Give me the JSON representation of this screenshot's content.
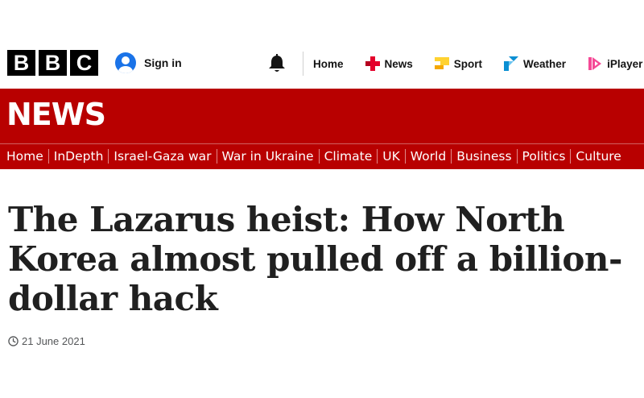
{
  "logo": {
    "letters": [
      "B",
      "B",
      "C"
    ]
  },
  "account": {
    "signin_label": "Sign in"
  },
  "topnav": [
    {
      "label": "Home",
      "icon": "none"
    },
    {
      "label": "News",
      "icon": "news-icon",
      "color": "#e4002b"
    },
    {
      "label": "Sport",
      "icon": "sport-icon",
      "color": "#ffd230"
    },
    {
      "label": "Weather",
      "icon": "weather-icon",
      "color": "#0a8fd3"
    },
    {
      "label": "iPlayer",
      "icon": "iplayer-icon",
      "color": "#f54996"
    }
  ],
  "news": {
    "logo": "NEWS",
    "bar_color": "#b80000",
    "sections": [
      "Home",
      "InDepth",
      "Israel-Gaza war",
      "War in Ukraine",
      "Climate",
      "UK",
      "World",
      "Business",
      "Politics",
      "Culture"
    ]
  },
  "article": {
    "headline": "The Lazarus heist: How North Korea almost pulled off a billion-dollar hack",
    "date": "21 June 2021"
  }
}
